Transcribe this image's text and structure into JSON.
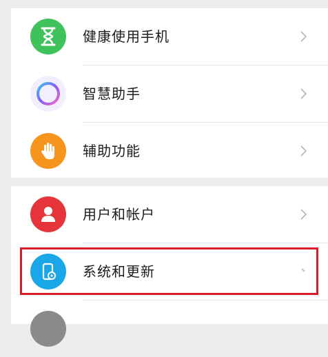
{
  "settings": {
    "group1": [
      {
        "label": "健康使用手机",
        "icon": "hourglass-icon",
        "color": "#3fc15b"
      },
      {
        "label": "智慧助手",
        "icon": "assistant-ring-icon",
        "color": "#8a7cf5"
      },
      {
        "label": "辅助功能",
        "icon": "hand-icon",
        "color": "#f7941d"
      }
    ],
    "group2": [
      {
        "label": "用户和帐户",
        "icon": "user-icon",
        "color": "#e5353b"
      },
      {
        "label": "系统和更新",
        "icon": "phone-settings-icon",
        "color": "#1aa7e8"
      },
      {
        "label": "",
        "icon": "gray-icon",
        "color": "#8a8a8a"
      }
    ]
  },
  "highlight": {
    "target": "系统和更新",
    "color": "#d81b26"
  }
}
